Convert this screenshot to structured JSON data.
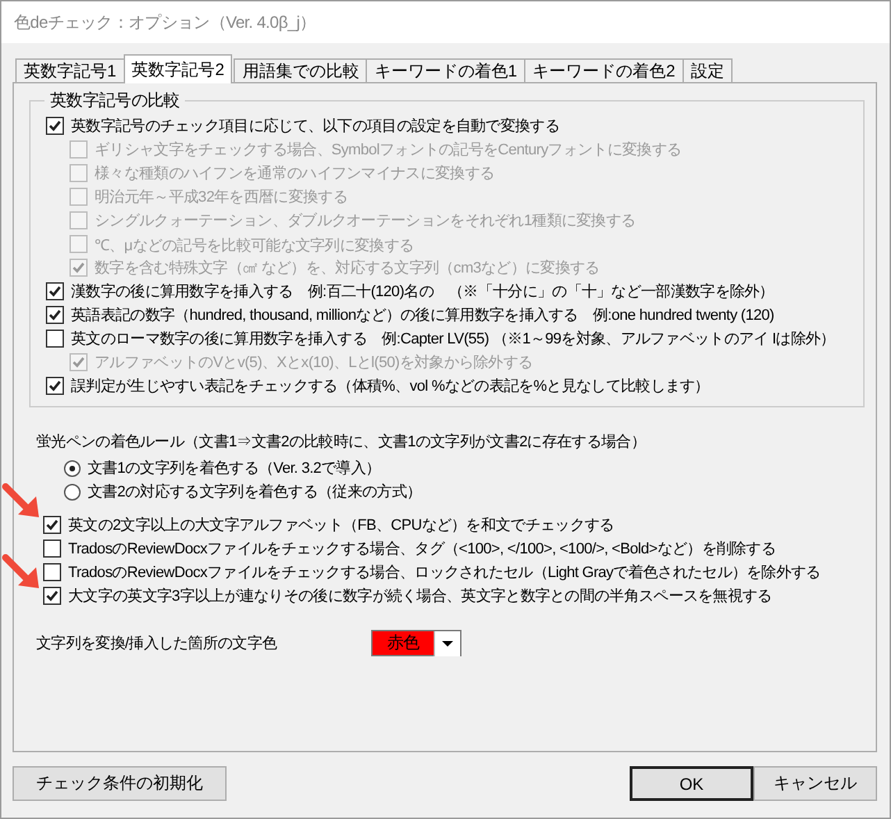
{
  "window": {
    "title": "色deチェック：オプション（Ver. 4.0β_j）"
  },
  "tabs": [
    {
      "label": "英数字記号1",
      "selected": false
    },
    {
      "label": "英数字記号2",
      "selected": true
    },
    {
      "label": "用語集での比較",
      "selected": false
    },
    {
      "label": "キーワードの着色1",
      "selected": false
    },
    {
      "label": "キーワードの着色2",
      "selected": false
    },
    {
      "label": "設定",
      "selected": false
    }
  ],
  "group": {
    "title": "英数字記号の比較",
    "items": [
      {
        "label": "英数字記号のチェック項目に応じて、以下の項目の設定を自動で変換する",
        "checked": true,
        "disabled": false,
        "children": [
          {
            "label": "ギリシャ文字をチェックする場合、Symbolフォントの記号をCenturyフォントに変換する",
            "checked": false,
            "disabled": true
          },
          {
            "label": "様々な種類のハイフンを通常のハイフンマイナスに変換する",
            "checked": false,
            "disabled": true
          },
          {
            "label": "明治元年～平成32年を西暦に変換する",
            "checked": false,
            "disabled": true
          },
          {
            "label": "シングルクォーテーション、ダブルクオーテーションをそれぞれ1種類に変換する",
            "checked": false,
            "disabled": true
          },
          {
            "label": "℃、μなどの記号を比較可能な文字列に変換する",
            "checked": false,
            "disabled": true
          },
          {
            "label": "数字を含む特殊文字（㎠ など）を、対応する文字列（cm3など）に変換する",
            "checked": true,
            "disabled": true
          }
        ]
      },
      {
        "label": "漢数字の後に算用数字を挿入する　例:百二十(120)名の　（※「十分に」の「十」など一部漢数字を除外）",
        "checked": true,
        "disabled": false
      },
      {
        "label": "英語表記の数字（hundred, thousand, millionなど）の後に算用数字を挿入する　例:one hundred twenty (120)",
        "checked": true,
        "disabled": false
      },
      {
        "label": "英文のローマ数字の後に算用数字を挿入する　例:Capter LV(55) （※1～99を対象、アルファベットのアイ Iは除外）",
        "checked": false,
        "disabled": false,
        "children": [
          {
            "label": "アルファベットのVとv(5)、Xとx(10)、Lとl(50)を対象から除外する",
            "checked": true,
            "disabled": true
          }
        ]
      },
      {
        "label": "誤判定が生じやすい表記をチェックする（体積%、vol %などの表記を%と見なして比較します）",
        "checked": true,
        "disabled": false
      }
    ]
  },
  "highlight_rule": {
    "heading": "蛍光ペンの着色ルール（文書1⇒文書2の比較時に、文書1の文字列が文書2に存在する場合）",
    "options": [
      {
        "label": "文書1の文字列を着色する（Ver. 3.2で導入）",
        "selected": true
      },
      {
        "label": "文書2の対応する文字列を着色する（従来の方式）",
        "selected": false
      }
    ]
  },
  "options": [
    {
      "label": "英文の2文字以上の大文字アルファベット（FB、CPUなど）を和文でチェックする",
      "checked": true,
      "arrow": true
    },
    {
      "label": "TradosのReviewDocxファイルをチェックする場合、タグ（<100>, </100>, <100/>, <Bold>など）を削除する",
      "checked": false,
      "arrow": false
    },
    {
      "label": "TradosのReviewDocxファイルをチェックする場合、ロックされたセル（Light Grayで着色されたセル）を除外する",
      "checked": false,
      "arrow": false
    },
    {
      "label": "大文字の英文字3字以上が連なりその後に数字が続く場合、英文字と数字との間の半角スペースを無視する",
      "checked": true,
      "arrow": true
    }
  ],
  "text_color": {
    "label": "文字列を変換/挿入した箇所の文字色",
    "value": "赤色",
    "color": "#ff0000"
  },
  "buttons": [
    {
      "label": "チェック条件の初期化",
      "kind": "reset",
      "default": false
    },
    {
      "label": "OK",
      "kind": "ok",
      "default": true
    },
    {
      "label": "キャンセル",
      "kind": "cancel",
      "default": false
    }
  ]
}
